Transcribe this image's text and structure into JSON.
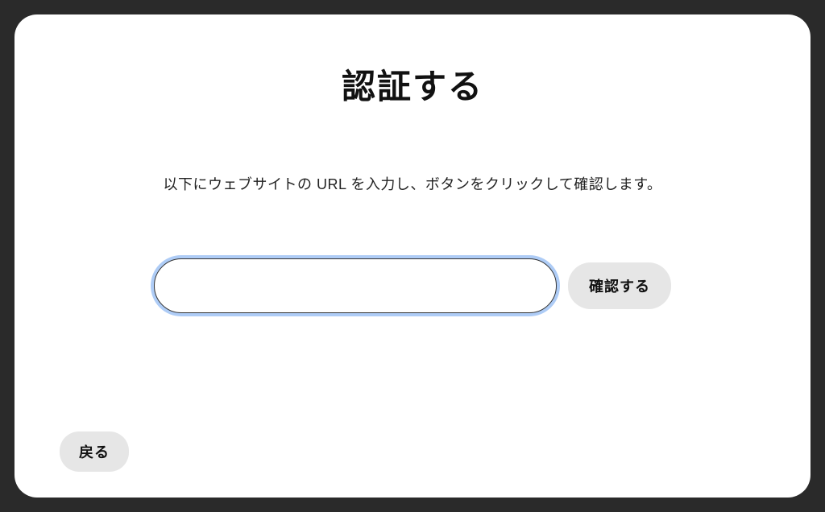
{
  "modal": {
    "title": "認証する",
    "description": "以下にウェブサイトの URL を入力し、ボタンをクリックして確認します。",
    "url_input": {
      "value": "",
      "placeholder": ""
    },
    "confirm_button_label": "確認する",
    "back_button_label": "戻る"
  }
}
